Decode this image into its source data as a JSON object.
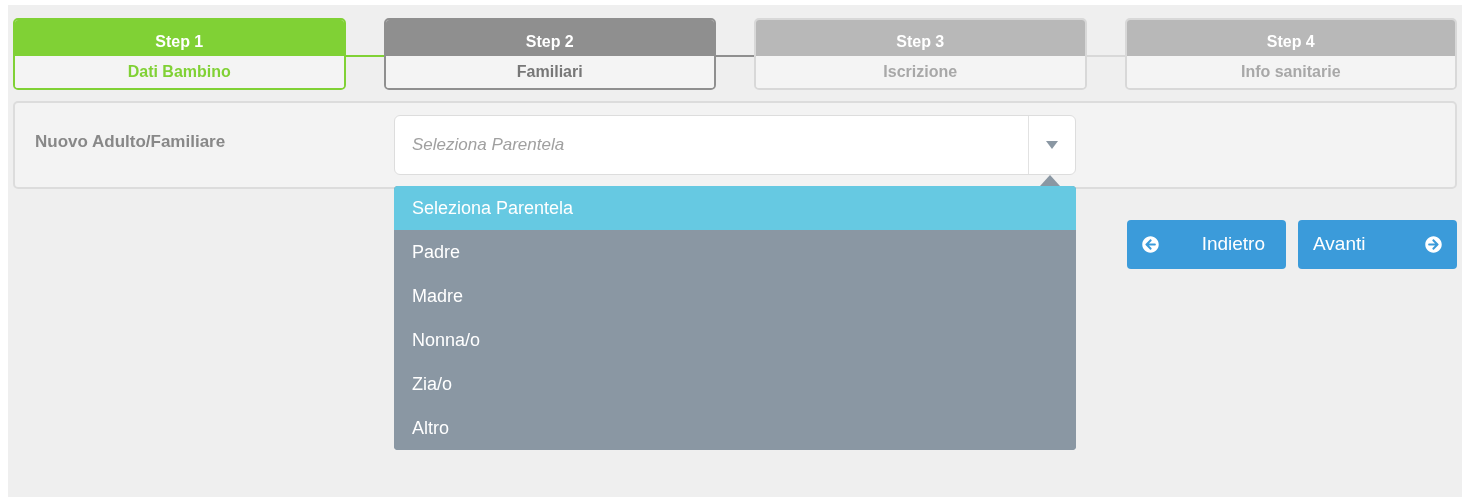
{
  "steps": [
    {
      "title": "Step 1",
      "label": "Dati Bambino",
      "completed": true,
      "selected": false
    },
    {
      "title": "Step 2",
      "label": "Familiari",
      "completed": false,
      "selected": true
    },
    {
      "title": "Step 3",
      "label": "Iscrizione",
      "completed": false,
      "selected": false
    },
    {
      "title": "Step 4",
      "label": "Info sanitarie",
      "completed": false,
      "selected": false
    }
  ],
  "form": {
    "label": "Nuovo Adulto/Familiare",
    "select": {
      "placeholder": "Seleziona Parentela",
      "expanded": true
    },
    "options": [
      {
        "label": "Seleziona Parentela",
        "selected": true
      },
      {
        "label": "Padre",
        "selected": false
      },
      {
        "label": "Madre",
        "selected": false
      },
      {
        "label": "Nonna/o",
        "selected": false
      },
      {
        "label": "Zia/o",
        "selected": false
      },
      {
        "label": "Altro",
        "selected": false
      }
    ]
  },
  "buttons": [
    {
      "label": "Indietro",
      "kind": "back"
    },
    {
      "label": "Avanti",
      "kind": "next"
    }
  ]
}
